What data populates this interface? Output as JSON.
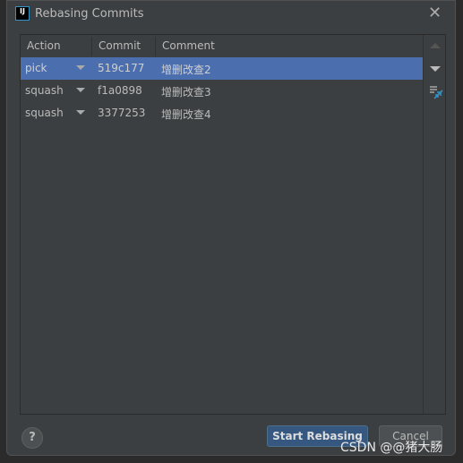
{
  "dialog": {
    "title": "Rebasing Commits",
    "logo_text": "IJ"
  },
  "table": {
    "columns": [
      "Action",
      "Commit",
      "Comment"
    ],
    "rows": [
      {
        "action": "pick",
        "commit": "519c177",
        "comment": "增删改查2",
        "selected": true
      },
      {
        "action": "squash",
        "commit": "f1a0898",
        "comment": "增删改查3"
      },
      {
        "action": "squash",
        "commit": "3377253",
        "comment": "增删改查4"
      }
    ]
  },
  "side_icons": [
    "move-up-icon",
    "move-down-icon",
    "squash-icon"
  ],
  "buttons": {
    "help": "?",
    "start": "Start Rebasing",
    "cancel": "Cancel"
  },
  "watermark": "CSDN @@猪大肠",
  "colors": {
    "selection": "#4b6eaf",
    "primary_button": "#365880",
    "dialog_bg": "#3c3f41"
  }
}
